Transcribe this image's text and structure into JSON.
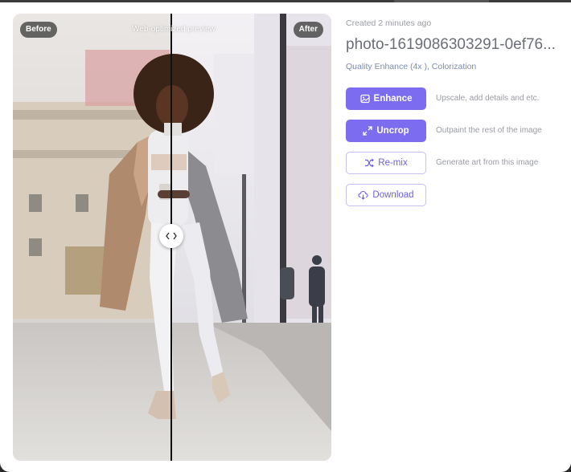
{
  "compare": {
    "before_label": "Before",
    "after_label": "After",
    "preview_note": "Web-optimized preview"
  },
  "info": {
    "created": "Created 2 minutes ago",
    "filename": "photo-1619086303291-0ef76...",
    "meta": "Quality Enhance (4x ), Colorization"
  },
  "actions": [
    {
      "label": "Enhance",
      "icon": "image-icon",
      "description": "Upscale, add details and etc."
    },
    {
      "label": "Uncrop",
      "icon": "expand-icon",
      "description": "Outpaint the rest of the image"
    },
    {
      "label": "Re-mix",
      "icon": "shuffle-icon",
      "description": "Generate art from this image"
    },
    {
      "label": "Download",
      "icon": "cloud-download-icon"
    }
  ],
  "colors": {
    "accent": "#7b6cf0",
    "accent_text": "#6c5fe0",
    "muted_text": "#9a9ca5"
  }
}
